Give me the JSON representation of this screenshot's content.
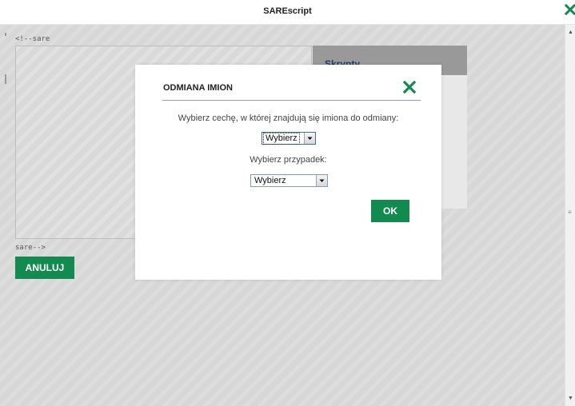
{
  "window": {
    "title": "SAREscript"
  },
  "editor": {
    "comment_open": "<!--sare",
    "comment_close": "sare-->"
  },
  "side_panel": {
    "title": "Skrypty"
  },
  "actions": {
    "cancel_label": "ANULUJ"
  },
  "dialog": {
    "title": "ODMIANA IMION",
    "feature_prompt": "Wybierz cechę, w której znajdują się imiona do odmiany:",
    "feature_select_value": "Wybierz",
    "case_prompt": "Wybierz przypadek:",
    "case_select_value": "Wybierz",
    "ok_label": "OK"
  },
  "colors": {
    "accent_green": "#138a4f",
    "panel_header": "#999999",
    "panel_title": "#1b3d6b"
  },
  "icons": {
    "dialog_close": "close-x-icon",
    "window_close": "close-x-icon",
    "select_arrow": "chevron-down-icon"
  }
}
